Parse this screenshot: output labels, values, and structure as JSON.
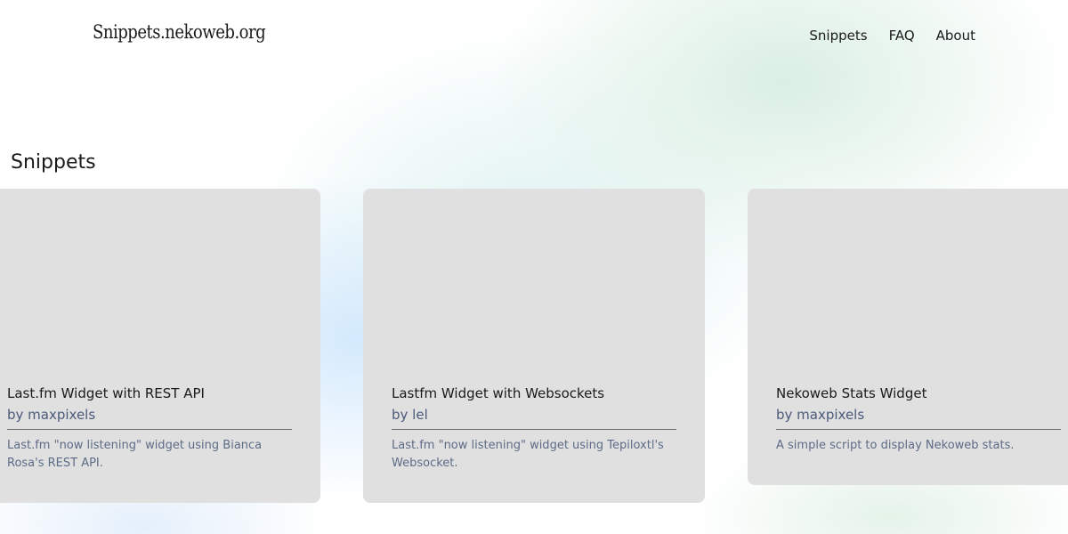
{
  "header": {
    "site_title": "Snippets.nekoweb.org",
    "nav": [
      "Snippets",
      "FAQ",
      "About"
    ]
  },
  "main": {
    "section_title": "Snippets",
    "cards": [
      {
        "title": "Last.fm Widget with REST API",
        "author": "by maxpixels",
        "description": "Last.fm \"now listening\" widget using Bianca Rosa's REST API."
      },
      {
        "title": "Lastfm Widget with Websockets",
        "author": "by lel",
        "description": "Last.fm \"now listening\" widget using Tepiloxtl's Websocket."
      },
      {
        "title": "Nekoweb Stats Widget",
        "author": "by maxpixels",
        "description": "A simple script to display Nekoweb stats."
      }
    ]
  },
  "colors": {
    "card_background": "#e0e0e0",
    "author_text": "#4a5a7a",
    "description_text": "#5d6b86"
  }
}
